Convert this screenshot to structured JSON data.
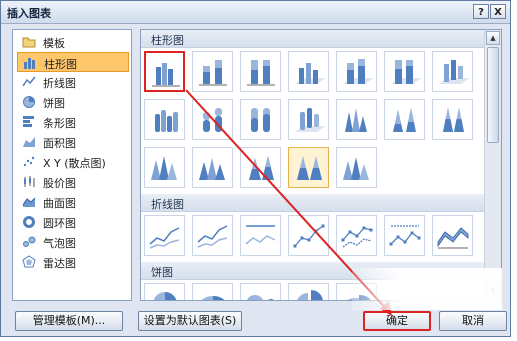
{
  "window": {
    "title": "插入图表",
    "help_label": "?",
    "close_label": "X"
  },
  "categories": [
    {
      "label": "模板",
      "icon": "folder-icon"
    },
    {
      "label": "柱形图",
      "icon": "column-chart-icon",
      "selected": true
    },
    {
      "label": "折线图",
      "icon": "line-chart-icon"
    },
    {
      "label": "饼图",
      "icon": "pie-chart-icon"
    },
    {
      "label": "条形图",
      "icon": "bar-chart-icon"
    },
    {
      "label": "面积图",
      "icon": "area-chart-icon"
    },
    {
      "label": "X Y (散点图)",
      "icon": "scatter-chart-icon"
    },
    {
      "label": "股价图",
      "icon": "stock-chart-icon"
    },
    {
      "label": "曲面图",
      "icon": "surface-chart-icon"
    },
    {
      "label": "圆环图",
      "icon": "doughnut-chart-icon"
    },
    {
      "label": "气泡图",
      "icon": "bubble-chart-icon"
    },
    {
      "label": "雷达图",
      "icon": "radar-chart-icon"
    }
  ],
  "gallery": {
    "sections": [
      {
        "title": "柱形图"
      },
      {
        "title": "折线图"
      },
      {
        "title": "饼图"
      }
    ]
  },
  "buttons": {
    "manage_templates": "管理模板(M)...",
    "set_default": "设置为默认图表(S)",
    "ok": "确定",
    "cancel": "取消"
  },
  "colors": {
    "selection": "#ffc76c",
    "annotation": "#dd2222",
    "accent_blue": "#4f7fc0"
  }
}
